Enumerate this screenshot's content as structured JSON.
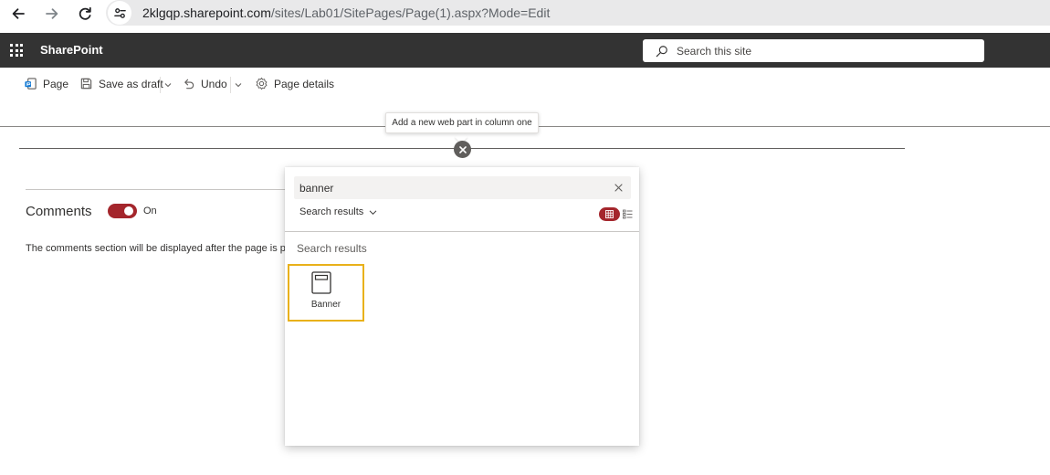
{
  "browser": {
    "url_host": "2klgqp.sharepoint.com",
    "url_path": "/sites/Lab01/SitePages/Page(1).aspx?Mode=Edit",
    "icons": {
      "back": "arrow-left-icon",
      "forward": "arrow-right-icon",
      "reload": "reload-icon",
      "site_info": "tune-icon"
    }
  },
  "suite_bar": {
    "brand": "SharePoint",
    "search_placeholder": "Search this site",
    "background": "#333333"
  },
  "command_bar": {
    "items": [
      {
        "label": "Page",
        "icon": "page-icon"
      },
      {
        "label": "Save as draft",
        "icon": "save-icon"
      },
      {
        "label": "Undo",
        "icon": "undo-icon"
      },
      {
        "label": "Page details",
        "icon": "gear-icon"
      }
    ]
  },
  "tooltip": {
    "text": "Add a new web part in column one"
  },
  "comments": {
    "title": "Comments",
    "toggle_state": "On",
    "note": "The comments section will be displayed after the page is published."
  },
  "toolbox": {
    "search_value": "banner",
    "filter_label": "Search results",
    "results_heading": "Search results",
    "results": [
      {
        "label": "Banner",
        "icon": "banner-icon"
      }
    ],
    "view_mode": "grid"
  },
  "colors": {
    "accent": "#a4262c",
    "selection_border": "#e9b11a",
    "suite_bar": "#333333",
    "text": "#323130"
  }
}
